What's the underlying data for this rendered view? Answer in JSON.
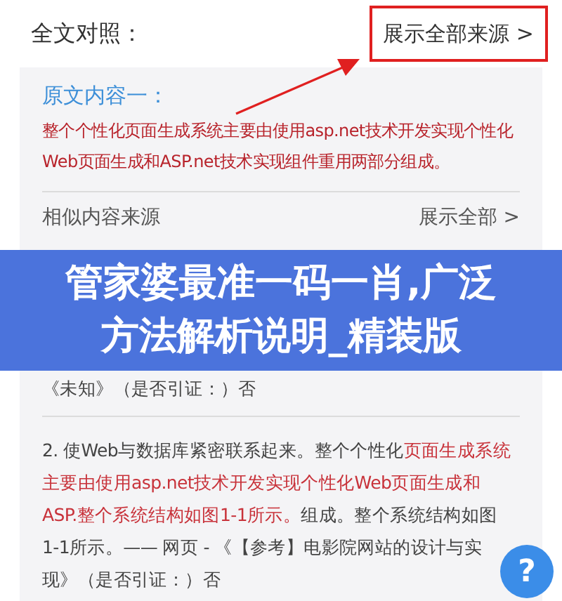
{
  "header": {
    "title": "全文对照：",
    "show_all_sources": "展示全部来源 >"
  },
  "original": {
    "heading": "原文内容一：",
    "text": "整个个性化页面生成系统主要由使用asp.net技术开发实现个性化Web页面生成和ASP.net技术实现组件重用两部分组成。"
  },
  "similar": {
    "heading": "相似内容来源",
    "show_all": "展示全部 >",
    "items": [
      {
        "segments": [
          {
            "text": "《未知》（是否引证：）否",
            "highlight": false
          }
        ]
      },
      {
        "segments": [
          {
            "text": "2. 使Web与数据库紧密联系起来。整个个性化",
            "highlight": false
          },
          {
            "text": "页面生成系统主要由使用asp.net技术开发实现个性化Web页面生成和ASP.整个系统结构如图1-1所示。",
            "highlight": true
          },
          {
            "text": "组成。整个系统结构如图1-1所示。—— 网页 - 《【参考】电影院网站的设计与实现》（是否引证：）否",
            "highlight": false
          }
        ]
      }
    ]
  },
  "banner": {
    "text": "管家婆最准一码一肖,广泛方法解析说明_精装版"
  },
  "help_button": {
    "label": "?"
  }
}
